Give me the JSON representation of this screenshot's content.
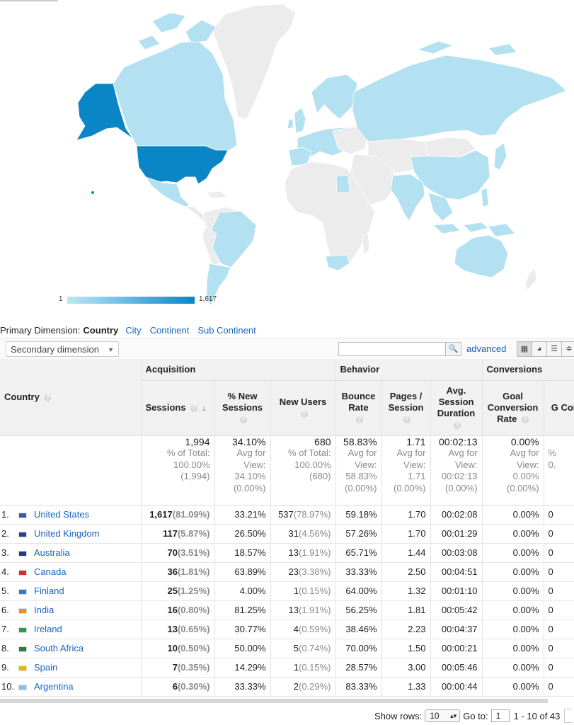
{
  "map": {
    "legend_min": "1",
    "legend_max": "1,617",
    "colors": {
      "land": "#ececec",
      "low": "#b3e1f2",
      "high": "#0a86c6"
    }
  },
  "dimensions": {
    "label": "Primary Dimension:",
    "active": "Country",
    "links": [
      "City",
      "Continent",
      "Sub Continent"
    ]
  },
  "toolbar": {
    "secondary_dimension": "Secondary dimension",
    "advanced": "advanced"
  },
  "table": {
    "groups": {
      "acquisition": "Acquisition",
      "behavior": "Behavior",
      "conversions": "Conversions"
    },
    "country_header": "Country",
    "columns": [
      "Sessions",
      "% New Sessions",
      "New Users",
      "Bounce Rate",
      "Pages / Session",
      "Avg. Session Duration",
      "Goal Conversion Rate",
      "G Comp"
    ],
    "totals": {
      "sessions": "1,994",
      "sessions_sub": [
        "% of Total:",
        "100.00%",
        "(1,994)"
      ],
      "new_sessions": "34.10%",
      "new_sessions_sub": [
        "Avg for",
        "View:",
        "34.10%",
        "(0.00%)"
      ],
      "new_users": "680",
      "new_users_sub": [
        "% of Total:",
        "100.00%",
        "(680)"
      ],
      "bounce": "58.83%",
      "bounce_sub": [
        "Avg for",
        "View:",
        "58.83%",
        "(0.00%)"
      ],
      "pages": "1.71",
      "pages_sub": [
        "Avg for",
        "View:",
        "1.71",
        "(0.00%)"
      ],
      "duration": "00:02:13",
      "duration_sub": [
        "Avg for",
        "View:",
        "00:02:13",
        "(0.00%)"
      ],
      "goal": "0.00%",
      "goal_sub": [
        "Avg for",
        "View:",
        "0.00%",
        "(0.00%)"
      ],
      "comp_sub": [
        "%",
        "0."
      ]
    },
    "rows": [
      {
        "idx": "1.",
        "country": "United States",
        "sessions": "1,617",
        "sessions_pct": "(81.09%)",
        "new_sessions": "33.21%",
        "new_users": "537",
        "new_users_pct": "(78.97%)",
        "bounce": "59.18%",
        "pages": "1.70",
        "duration": "00:02:08",
        "goal": "0.00%",
        "comp": "0"
      },
      {
        "idx": "2.",
        "country": "United Kingdom",
        "sessions": "117",
        "sessions_pct": "(5.87%)",
        "new_sessions": "26.50%",
        "new_users": "31",
        "new_users_pct": "(4.56%)",
        "bounce": "57.26%",
        "pages": "1.70",
        "duration": "00:01:29",
        "goal": "0.00%",
        "comp": "0"
      },
      {
        "idx": "3.",
        "country": "Australia",
        "sessions": "70",
        "sessions_pct": "(3.51%)",
        "new_sessions": "18.57%",
        "new_users": "13",
        "new_users_pct": "(1.91%)",
        "bounce": "65.71%",
        "pages": "1.44",
        "duration": "00:03:08",
        "goal": "0.00%",
        "comp": "0"
      },
      {
        "idx": "4.",
        "country": "Canada",
        "sessions": "36",
        "sessions_pct": "(1.81%)",
        "new_sessions": "63.89%",
        "new_users": "23",
        "new_users_pct": "(3.38%)",
        "bounce": "33.33%",
        "pages": "2.50",
        "duration": "00:04:51",
        "goal": "0.00%",
        "comp": "0"
      },
      {
        "idx": "5.",
        "country": "Finland",
        "sessions": "25",
        "sessions_pct": "(1.25%)",
        "new_sessions": "4.00%",
        "new_users": "1",
        "new_users_pct": "(0.15%)",
        "bounce": "64.00%",
        "pages": "1.32",
        "duration": "00:01:10",
        "goal": "0.00%",
        "comp": "0"
      },
      {
        "idx": "6.",
        "country": "India",
        "sessions": "16",
        "sessions_pct": "(0.80%)",
        "new_sessions": "81.25%",
        "new_users": "13",
        "new_users_pct": "(1.91%)",
        "bounce": "56.25%",
        "pages": "1.81",
        "duration": "00:05:42",
        "goal": "0.00%",
        "comp": "0"
      },
      {
        "idx": "7.",
        "country": "Ireland",
        "sessions": "13",
        "sessions_pct": "(0.65%)",
        "new_sessions": "30.77%",
        "new_users": "4",
        "new_users_pct": "(0.59%)",
        "bounce": "38.46%",
        "pages": "2.23",
        "duration": "00:04:37",
        "goal": "0.00%",
        "comp": "0"
      },
      {
        "idx": "8.",
        "country": "South Africa",
        "sessions": "10",
        "sessions_pct": "(0.50%)",
        "new_sessions": "50.00%",
        "new_users": "5",
        "new_users_pct": "(0.74%)",
        "bounce": "70.00%",
        "pages": "1.50",
        "duration": "00:00:21",
        "goal": "0.00%",
        "comp": "0"
      },
      {
        "idx": "9.",
        "country": "Spain",
        "sessions": "7",
        "sessions_pct": "(0.35%)",
        "new_sessions": "14.29%",
        "new_users": "1",
        "new_users_pct": "(0.15%)",
        "bounce": "28.57%",
        "pages": "3.00",
        "duration": "00:05:46",
        "goal": "0.00%",
        "comp": "0"
      },
      {
        "idx": "10.",
        "country": "Argentina",
        "sessions": "6",
        "sessions_pct": "(0.30%)",
        "new_sessions": "33.33%",
        "new_users": "2",
        "new_users_pct": "(0.29%)",
        "bounce": "83.33%",
        "pages": "1.33",
        "duration": "00:00:44",
        "goal": "0.00%",
        "comp": "0"
      }
    ]
  },
  "footer": {
    "show_rows_label": "Show rows:",
    "show_rows_value": "10",
    "goto_label": "Go to:",
    "goto_value": "1",
    "range": "1 - 10 of 43"
  }
}
